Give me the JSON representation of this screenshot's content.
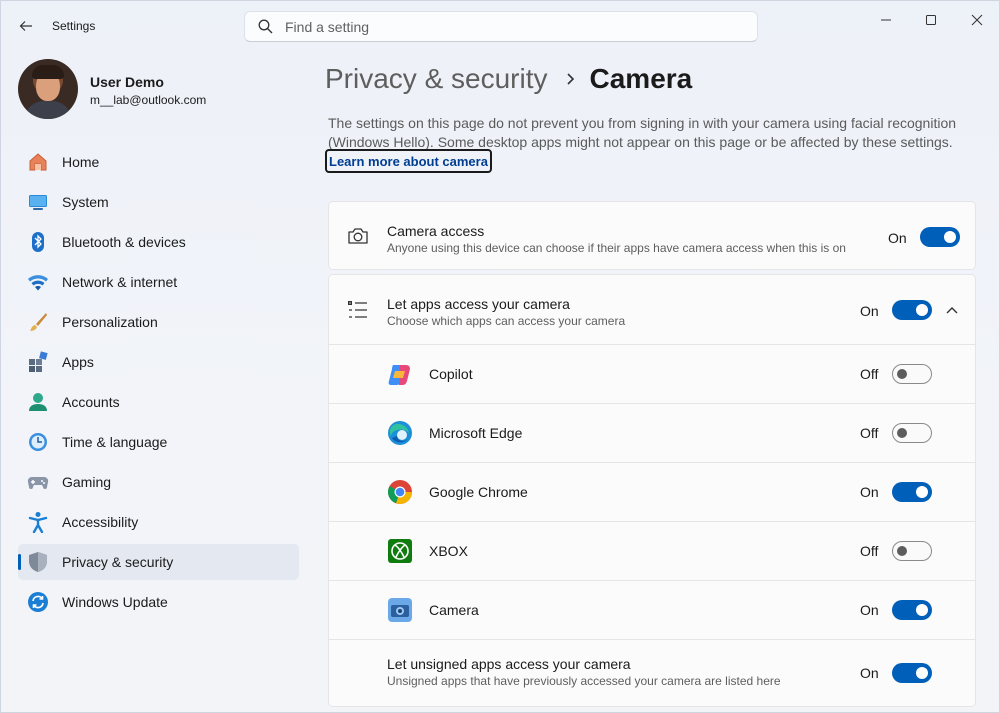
{
  "window": {
    "app_title": "Settings",
    "back_icon": "back-arrow-icon",
    "controls": [
      "minimize-icon",
      "maximize-icon",
      "close-icon"
    ]
  },
  "search": {
    "placeholder": "Find a setting",
    "value": ""
  },
  "profile": {
    "name": "User Demo",
    "email": "m__lab@outlook.com"
  },
  "sidebar": {
    "items": [
      {
        "label": "Home",
        "icon": "home-icon",
        "selected": false
      },
      {
        "label": "System",
        "icon": "monitor-icon",
        "selected": false
      },
      {
        "label": "Bluetooth & devices",
        "icon": "bluetooth-icon",
        "selected": false
      },
      {
        "label": "Network & internet",
        "icon": "wifi-icon",
        "selected": false
      },
      {
        "label": "Personalization",
        "icon": "paintbrush-icon",
        "selected": false
      },
      {
        "label": "Apps",
        "icon": "apps-icon",
        "selected": false
      },
      {
        "label": "Accounts",
        "icon": "person-icon",
        "selected": false
      },
      {
        "label": "Time & language",
        "icon": "clock-globe-icon",
        "selected": false
      },
      {
        "label": "Gaming",
        "icon": "gamepad-icon",
        "selected": false
      },
      {
        "label": "Accessibility",
        "icon": "accessibility-icon",
        "selected": false
      },
      {
        "label": "Privacy & security",
        "icon": "shield-icon",
        "selected": true
      },
      {
        "label": "Windows Update",
        "icon": "update-icon",
        "selected": false
      }
    ]
  },
  "breadcrumb": {
    "parent": "Privacy & security",
    "current": "Camera"
  },
  "description": "The settings on this page do not prevent you from signing in with your camera using facial recognition (Windows Hello). Some desktop apps might not appear on this page or be affected by these settings.",
  "learn_more": "Learn more about camera",
  "camera_access": {
    "title": "Camera access",
    "subtitle": "Anyone using this device can choose if their apps have camera access when this is on",
    "state": "On",
    "icon": "camera-icon"
  },
  "apps_access": {
    "title": "Let apps access your camera",
    "subtitle": "Choose which apps can access your camera",
    "state": "On",
    "icon": "list-icon",
    "expanded": true,
    "apps": [
      {
        "name": "Copilot",
        "state": "Off",
        "icon": "copilot-icon"
      },
      {
        "name": "Microsoft Edge",
        "state": "Off",
        "icon": "edge-icon"
      },
      {
        "name": "Google Chrome",
        "state": "On",
        "icon": "chrome-icon"
      },
      {
        "name": "XBOX",
        "state": "Off",
        "icon": "xbox-icon"
      },
      {
        "name": "Camera",
        "state": "On",
        "icon": "camera-app-icon"
      }
    ],
    "unsigned": {
      "title": "Let unsigned apps access your camera",
      "subtitle": "Unsigned apps that have previously accessed your camera are listed here",
      "state": "On"
    }
  },
  "colors": {
    "accent": "#005fb8",
    "toggle_off_knob": "#5d5d5d"
  }
}
